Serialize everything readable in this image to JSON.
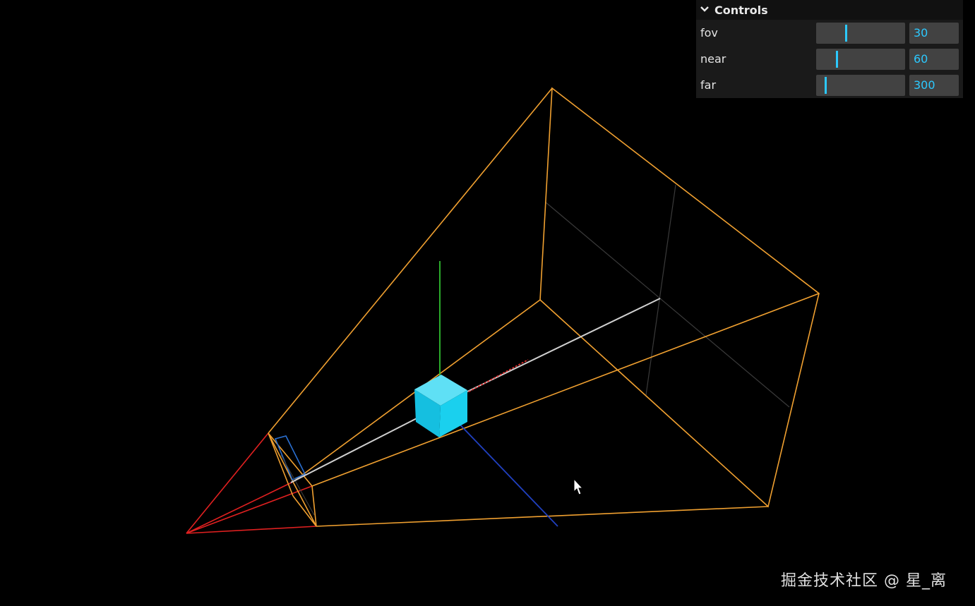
{
  "gui": {
    "title": "Controls",
    "collapse_icon": "chevron-down-icon",
    "params": [
      {
        "key": "fov",
        "label": "fov",
        "value": "30",
        "fraction": 0.33
      },
      {
        "key": "near",
        "label": "near",
        "value": "60",
        "fraction": 0.23
      },
      {
        "key": "far",
        "label": "far",
        "value": "300",
        "fraction": 0.1
      }
    ],
    "accent": "#2cc9ff"
  },
  "scene": {
    "frustum_color": "#f0a030",
    "near_cone_color": "#e02020",
    "cube_color": "#20c8e8",
    "axis_x_color": "#e03030",
    "axis_y_color": "#30c030",
    "axis_z_color": "#2040c0",
    "center_line_color": "#d8d8d8",
    "up_marker_color": "#2a6fd0",
    "cursor_icon": "arrow-cursor-icon"
  },
  "watermark": "掘金技术社区 @ 星_离"
}
